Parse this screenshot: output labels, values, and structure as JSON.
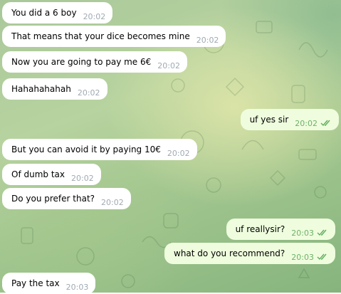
{
  "chat": {
    "messages": [
      {
        "direction": "in",
        "text": "You did a 6 boy",
        "time": "20:02"
      },
      {
        "direction": "in",
        "text": "That means that your dice becomes mine",
        "time": "20:02"
      },
      {
        "direction": "in",
        "text": "Now you are going to pay me 6€",
        "time": "20:02"
      },
      {
        "direction": "in",
        "text": "Hahahahahah",
        "time": "20:02"
      },
      {
        "direction": "out",
        "text": "uf yes sir",
        "time": "20:02",
        "status": "read"
      },
      {
        "direction": "in",
        "text": "But you can avoid it by paying 10€",
        "time": "20:02"
      },
      {
        "direction": "in",
        "text": "Of dumb tax",
        "time": "20:02"
      },
      {
        "direction": "in",
        "text": "Do you prefer that?",
        "time": "20:02"
      },
      {
        "direction": "out",
        "text": "uf reallysir?",
        "time": "20:03",
        "status": "read"
      },
      {
        "direction": "out",
        "text": "what do you recommend?",
        "time": "20:03",
        "status": "read"
      },
      {
        "direction": "in",
        "text": "Pay the tax",
        "time": "20:03"
      }
    ]
  },
  "colors": {
    "incoming_bubble": "#ffffff",
    "outgoing_bubble": "#effdde",
    "incoming_time": "#a1aab3",
    "outgoing_time": "#6fb16a",
    "read_checks": "#5fae5b"
  }
}
